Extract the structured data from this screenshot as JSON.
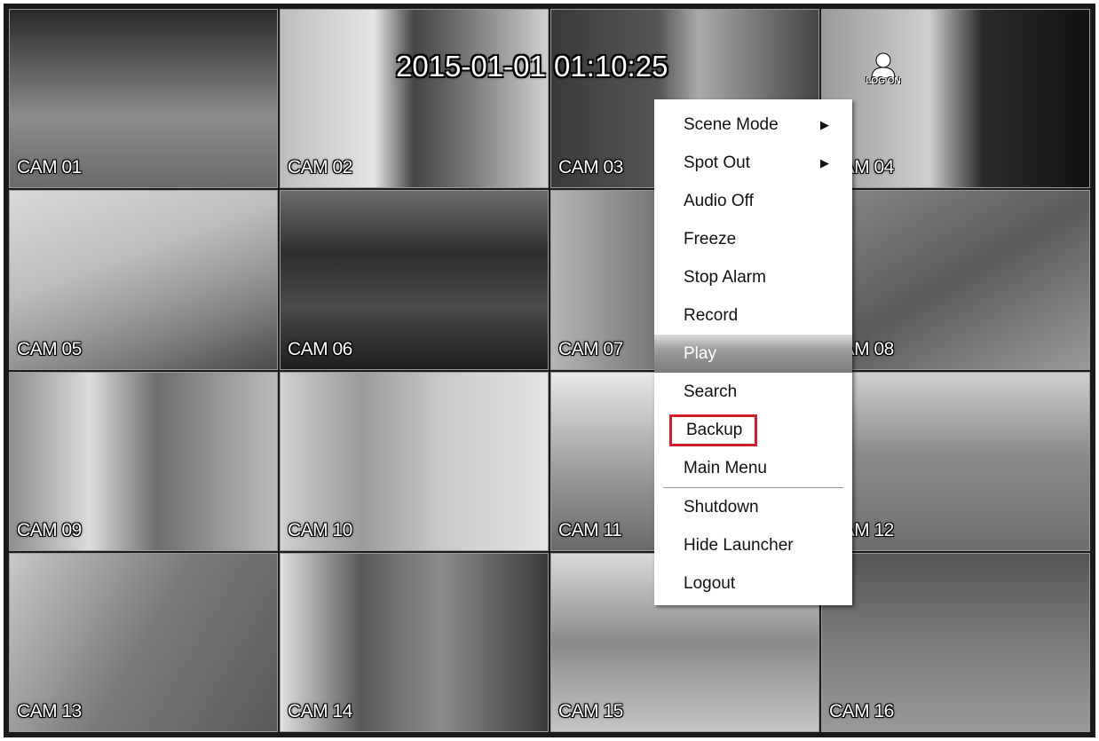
{
  "timestamp": "2015-01-01 01:10:25",
  "logon_label": "LOG ON",
  "cameras": [
    {
      "label": "CAM 01",
      "scene": "s-garage"
    },
    {
      "label": "CAM 02",
      "scene": "s-lobby"
    },
    {
      "label": "CAM 03",
      "scene": "s-door"
    },
    {
      "label": "CAM 04",
      "scene": "s-entrance"
    },
    {
      "label": "CAM 05",
      "scene": "s-stairs1"
    },
    {
      "label": "CAM 06",
      "scene": "s-street"
    },
    {
      "label": "CAM 07",
      "scene": "s-hall1"
    },
    {
      "label": "CAM 08",
      "scene": "s-parking"
    },
    {
      "label": "CAM 09",
      "scene": "s-corridor"
    },
    {
      "label": "CAM 10",
      "scene": "s-elevator"
    },
    {
      "label": "CAM 11",
      "scene": "s-office1"
    },
    {
      "label": "CAM 12",
      "scene": "s-office2"
    },
    {
      "label": "CAM 13",
      "scene": "s-stairs2"
    },
    {
      "label": "CAM 14",
      "scene": "s-elev2"
    },
    {
      "label": "CAM 15",
      "scene": "s-atrium"
    },
    {
      "label": "CAM 16",
      "scene": "s-road"
    }
  ],
  "menu": {
    "items": [
      {
        "label": "Scene Mode",
        "submenu": true
      },
      {
        "label": "Spot Out",
        "submenu": true
      },
      {
        "label": "Audio Off"
      },
      {
        "label": "Freeze"
      },
      {
        "label": "Stop Alarm"
      },
      {
        "label": "Record"
      },
      {
        "label": "Play",
        "state": "hovered"
      },
      {
        "label": "Search"
      },
      {
        "label": "Backup",
        "state": "outlined"
      },
      {
        "label": "Main Menu"
      },
      {
        "label": "Shutdown"
      },
      {
        "label": "Hide Launcher"
      },
      {
        "label": "Logout"
      }
    ],
    "arrow_glyph": "▶",
    "highlight_color": "#d0202a",
    "hover_color": "#8c8c8c"
  }
}
